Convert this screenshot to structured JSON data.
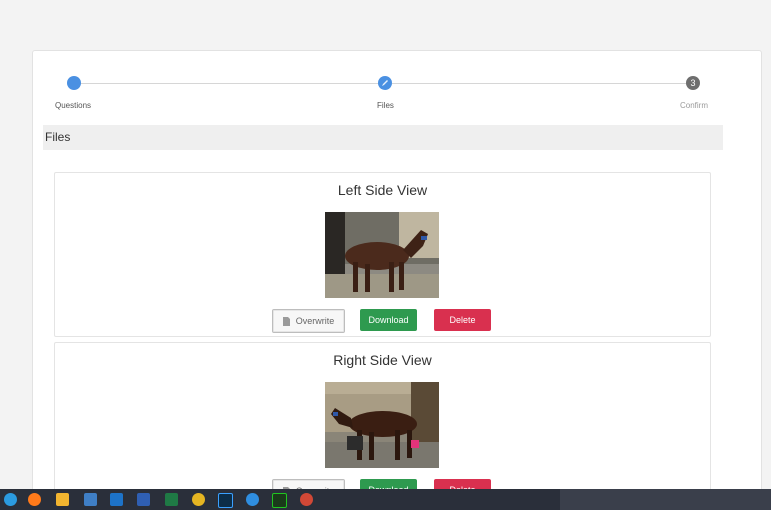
{
  "stepper": {
    "steps": [
      {
        "label": "Questions",
        "state": "done"
      },
      {
        "label": "Files",
        "state": "done"
      },
      {
        "label": "Confirm",
        "number": "3",
        "state": "pending"
      }
    ]
  },
  "section": {
    "title": "Files"
  },
  "files": [
    {
      "title": "Left Side View",
      "overwrite_label": "Overwrite",
      "download_label": "Download",
      "delete_label": "Delete"
    },
    {
      "title": "Right Side View",
      "overwrite_label": "Overwrite",
      "download_label": "Download",
      "delete_label": "Delete"
    }
  ],
  "colors": {
    "step_done": "#4a90e2",
    "step_pending": "#6e6e6e",
    "download": "#2e9a4f",
    "delete": "#d9304f"
  },
  "taskbar": {
    "icons": [
      "start-icon",
      "firefox-icon",
      "file-explorer-icon",
      "calculator-icon",
      "photos-icon",
      "word-icon",
      "excel-icon",
      "chrome-icon",
      "photoshop-icon",
      "edge-icon",
      "terminal-icon",
      "chrome-alt-icon"
    ]
  }
}
